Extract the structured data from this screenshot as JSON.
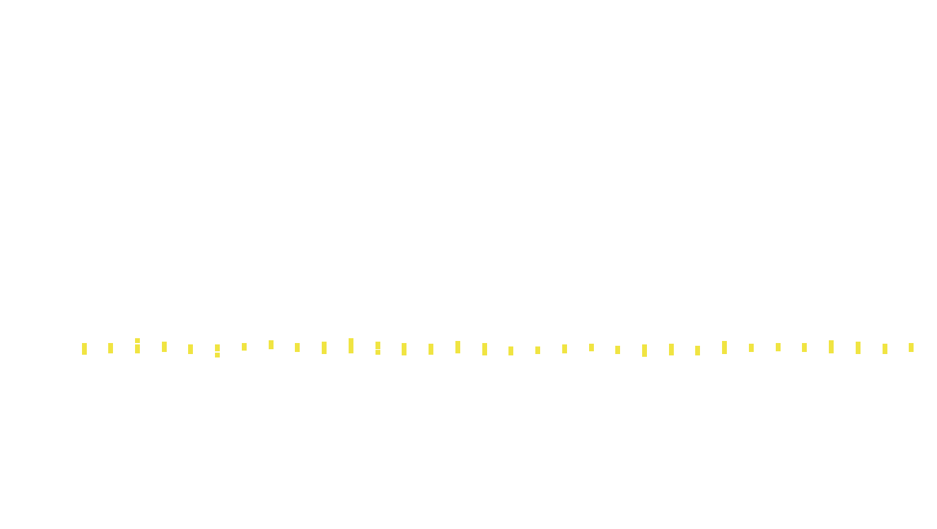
{
  "page": {
    "background": "#ffffff"
  },
  "marks": {
    "color": "#f0e442",
    "count": 32,
    "segments_per_mark": [
      1,
      1,
      2,
      1,
      1,
      2,
      1,
      1,
      1,
      1,
      1,
      2,
      1,
      1,
      1,
      1,
      1,
      1,
      1,
      1,
      1,
      1,
      1,
      1,
      1,
      1,
      1,
      1,
      1,
      1,
      1,
      1
    ]
  }
}
